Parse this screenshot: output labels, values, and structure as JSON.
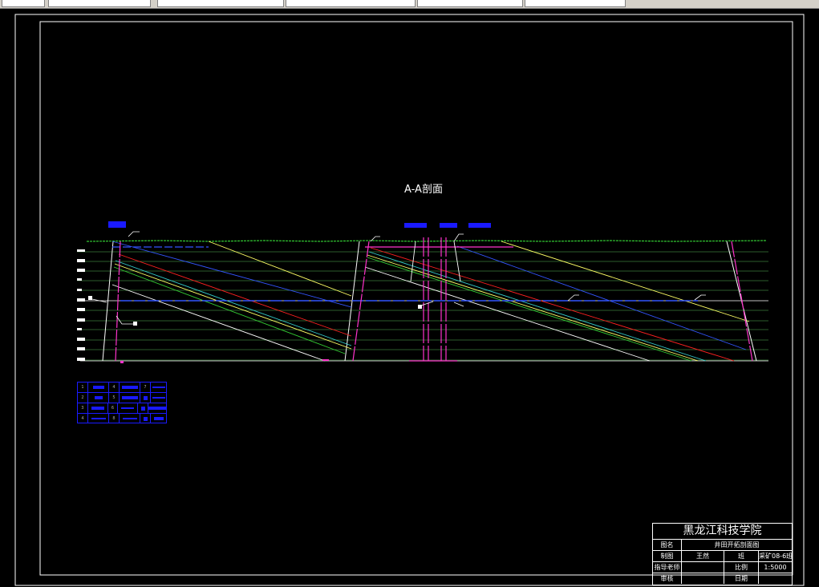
{
  "drawing": {
    "section_title": "A-A剖面"
  },
  "title_block": {
    "institution": "黑龙江科技学院",
    "rows": [
      {
        "label": "图名",
        "value": "井田开拓剖面图"
      },
      {
        "label": "制图",
        "v1": "王然",
        "v2": "班",
        "v3": "采矿08-6班"
      },
      {
        "label": "指导老师",
        "v1": "",
        "v2": "比例",
        "v3": "1:5000"
      },
      {
        "label": "审核",
        "v1": "",
        "v2": "日期",
        "v3": ""
      }
    ]
  },
  "colors": {
    "background": "#000000",
    "frame": "#ffffff",
    "ground": "#33cc33",
    "coal_seam_red": "#ff2020",
    "coal_seam_yellow": "#ffff66",
    "coal_seam_blue": "#3355ff",
    "shaft": "#ff33cc",
    "legend": "#1a1aff"
  },
  "legend": {
    "rows": 4
  }
}
